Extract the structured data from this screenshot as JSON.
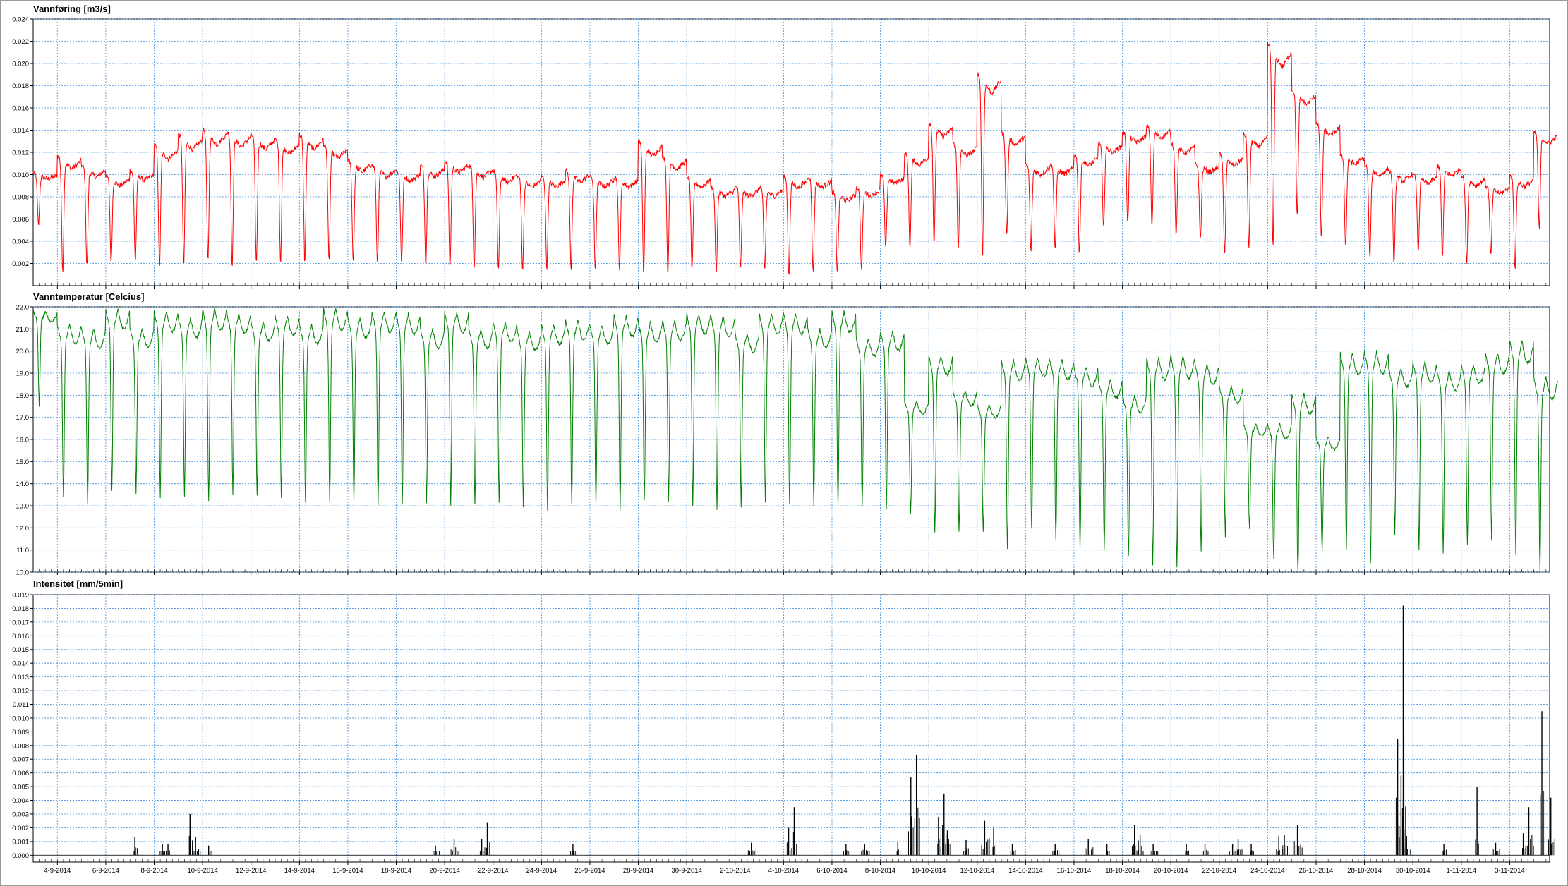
{
  "chart_data": [
    {
      "type": "line",
      "title": "Vannføring [m3/s]",
      "color": "#ff0000",
      "grid": true,
      "ylim": [
        0.0,
        0.024
      ],
      "yticks": [
        "0.002",
        "0.004",
        "0.006",
        "0.008",
        "0.010",
        "0.012",
        "0.014",
        "0.016",
        "0.018",
        "0.020",
        "0.022",
        "0.024"
      ],
      "xlim": [
        "2014-09-03",
        "2014-11-04"
      ],
      "series": [
        {
          "x": [
            "2014-09-03",
            "2014-09-04",
            "2014-09-05",
            "2014-09-06",
            "2014-09-07",
            "2014-09-08",
            "2014-09-09",
            "2014-09-10",
            "2014-09-11",
            "2014-09-12",
            "2014-09-13",
            "2014-09-14",
            "2014-09-15",
            "2014-09-16",
            "2014-09-17",
            "2014-09-18",
            "2014-09-19",
            "2014-09-20",
            "2014-09-21",
            "2014-09-22",
            "2014-09-23",
            "2014-09-24",
            "2014-09-25",
            "2014-09-26",
            "2014-09-27",
            "2014-09-28",
            "2014-09-29",
            "2014-09-30",
            "2014-10-01",
            "2014-10-02",
            "2014-10-03",
            "2014-10-04",
            "2014-10-05",
            "2014-10-06",
            "2014-10-07",
            "2014-10-08",
            "2014-10-09",
            "2014-10-10",
            "2014-10-11",
            "2014-10-12",
            "2014-10-13",
            "2014-10-14",
            "2014-10-15",
            "2014-10-16",
            "2014-10-17",
            "2014-10-18",
            "2014-10-19",
            "2014-10-20",
            "2014-10-21",
            "2014-10-22",
            "2014-10-23",
            "2014-10-24",
            "2014-10-25",
            "2014-10-26",
            "2014-10-27",
            "2014-10-28",
            "2014-10-29",
            "2014-10-30",
            "2014-10-31",
            "2014-11-01",
            "2014-11-02",
            "2014-11-03",
            "2014-11-04"
          ],
          "daily_max": [
            0.0105,
            0.0125,
            0.0115,
            0.0105,
            0.011,
            0.0135,
            0.0145,
            0.015,
            0.0148,
            0.0145,
            0.014,
            0.0145,
            0.0135,
            0.012,
            0.0115,
            0.011,
            0.0115,
            0.012,
            0.0115,
            0.011,
            0.0105,
            0.0105,
            0.011,
            0.0105,
            0.0105,
            0.014,
            0.0125,
            0.0105,
            0.0095,
            0.0095,
            0.0095,
            0.0105,
            0.0105,
            0.009,
            0.0095,
            0.0105,
            0.0125,
            0.0155,
            0.0135,
            0.0205,
            0.0145,
            0.0115,
            0.0115,
            0.0125,
            0.0135,
            0.0145,
            0.015,
            0.0135,
            0.0115,
            0.0125,
            0.0145,
            0.0232,
            0.0185,
            0.0155,
            0.0125,
            0.0115,
            0.011,
            0.0105,
            0.0115,
            0.0105,
            0.0095,
            0.0105,
            0.0145
          ],
          "daily_min": [
            0.006,
            0.0025,
            0.0028,
            0.003,
            0.0032,
            0.003,
            0.0032,
            0.0035,
            0.0032,
            0.0033,
            0.0034,
            0.0034,
            0.0033,
            0.0032,
            0.003,
            0.003,
            0.003,
            0.0028,
            0.0027,
            0.0025,
            0.0024,
            0.0025,
            0.0025,
            0.0024,
            0.0024,
            0.0023,
            0.0024,
            0.0024,
            0.0022,
            0.0023,
            0.0022,
            0.002,
            0.0022,
            0.0021,
            0.0022,
            0.004,
            0.0045,
            0.005,
            0.0045,
            0.0045,
            0.0055,
            0.004,
            0.0042,
            0.004,
            0.006,
            0.0065,
            0.0065,
            0.0055,
            0.005,
            0.004,
            0.0045,
            0.0055,
            0.0075,
            0.0055,
            0.0045,
            0.0035,
            0.003,
            0.004,
            0.0035,
            0.003,
            0.0035,
            0.0025,
            0.006
          ]
        }
      ]
    },
    {
      "type": "line",
      "title": "Vanntemperatur [Celcius]",
      "color": "#008000",
      "grid": true,
      "ylim": [
        10.0,
        22.0
      ],
      "yticks": [
        "10.0",
        "11.0",
        "12.0",
        "13.0",
        "14.0",
        "15.0",
        "16.0",
        "17.0",
        "18.0",
        "19.0",
        "20.0",
        "21.0",
        "22.0"
      ],
      "xlim": [
        "2014-09-03",
        "2014-11-04"
      ],
      "series": [
        {
          "x": [
            "2014-09-03",
            "2014-09-04",
            "2014-09-05",
            "2014-09-06",
            "2014-09-07",
            "2014-09-08",
            "2014-09-09",
            "2014-09-10",
            "2014-09-11",
            "2014-09-12",
            "2014-09-13",
            "2014-09-14",
            "2014-09-15",
            "2014-09-16",
            "2014-09-17",
            "2014-09-18",
            "2014-09-19",
            "2014-09-20",
            "2014-09-21",
            "2014-09-22",
            "2014-09-23",
            "2014-09-24",
            "2014-09-25",
            "2014-09-26",
            "2014-09-27",
            "2014-09-28",
            "2014-09-29",
            "2014-09-30",
            "2014-10-01",
            "2014-10-02",
            "2014-10-03",
            "2014-10-04",
            "2014-10-05",
            "2014-10-06",
            "2014-10-07",
            "2014-10-08",
            "2014-10-09",
            "2014-10-10",
            "2014-10-11",
            "2014-10-12",
            "2014-10-13",
            "2014-10-14",
            "2014-10-15",
            "2014-10-16",
            "2014-10-17",
            "2014-10-18",
            "2014-10-19",
            "2014-10-20",
            "2014-10-21",
            "2014-10-22",
            "2014-10-23",
            "2014-10-24",
            "2014-10-25",
            "2014-10-26",
            "2014-10-27",
            "2014-10-28",
            "2014-10-29",
            "2014-10-30",
            "2014-10-31",
            "2014-11-01",
            "2014-11-02",
            "2014-11-03",
            "2014-11-04"
          ],
          "daily_max": [
            21.8,
            21.2,
            21.0,
            21.9,
            21.0,
            21.8,
            21.5,
            21.9,
            21.7,
            21.3,
            21.6,
            21.2,
            21.9,
            21.5,
            21.8,
            21.7,
            21.0,
            21.8,
            21.0,
            21.3,
            20.9,
            21.2,
            21.4,
            21.2,
            21.6,
            21.3,
            21.4,
            21.7,
            21.6,
            20.8,
            21.7,
            21.7,
            21.0,
            21.8,
            20.6,
            20.9,
            17.7,
            19.8,
            18.2,
            17.6,
            19.6,
            19.7,
            19.6,
            19.3,
            18.7,
            18.0,
            19.7,
            19.8,
            19.4,
            18.4,
            16.7,
            16.7,
            18.1,
            16.1,
            19.9,
            20.0,
            19.2,
            19.5,
            19.1,
            19.4,
            19.9,
            20.5,
            18.8
          ],
          "daily_min": [
            18.0,
            14.2,
            13.9,
            14.6,
            14.4,
            14.3,
            14.3,
            14.1,
            14.4,
            14.3,
            14.2,
            14.0,
            14.1,
            14.1,
            14.0,
            14.0,
            14.0,
            14.0,
            13.9,
            14.0,
            13.8,
            13.7,
            14.0,
            13.9,
            13.8,
            14.1,
            14.1,
            13.9,
            13.7,
            13.8,
            14.0,
            14.0,
            13.9,
            13.9,
            13.8,
            13.7,
            13.2,
            12.6,
            12.5,
            12.4,
            12.0,
            12.8,
            12.3,
            12.0,
            11.9,
            11.5,
            11.3,
            11.2,
            11.9,
            12.3,
            12.4,
            11.3,
            10.5,
            11.5,
            11.9,
            11.5,
            12.5,
            11.9,
            11.7,
            12.1,
            12.4,
            11.8,
            10.9
          ]
        }
      ]
    },
    {
      "type": "bar",
      "title": "Intensitet [mm/5min]",
      "color": "#000000",
      "grid": true,
      "ylim": [
        -0.0005,
        0.019
      ],
      "yticks": [
        "0.000",
        "0.001",
        "0.002",
        "0.003",
        "0.004",
        "0.005",
        "0.006",
        "0.007",
        "0.008",
        "0.009",
        "0.010",
        "0.011",
        "0.012",
        "0.013",
        "0.014",
        "0.015",
        "0.016",
        "0.017",
        "0.018",
        "0.019"
      ],
      "xlim": [
        "2014-09-03",
        "2014-11-04"
      ],
      "series": [
        {
          "x": [
            "2014-09-07",
            "2014-09-08",
            "2014-09-08",
            "2014-09-09",
            "2014-09-09",
            "2014-09-10",
            "2014-09-19",
            "2014-09-20",
            "2014-09-21",
            "2014-09-21",
            "2014-09-25",
            "2014-10-02",
            "2014-10-04",
            "2014-10-04",
            "2014-10-06",
            "2014-10-07",
            "2014-10-08",
            "2014-10-09",
            "2014-10-09",
            "2014-10-10",
            "2014-10-10",
            "2014-10-10",
            "2014-10-11",
            "2014-10-12",
            "2014-10-12",
            "2014-10-13",
            "2014-10-15",
            "2014-10-16",
            "2014-10-17",
            "2014-10-18",
            "2014-10-18",
            "2014-10-19",
            "2014-10-20",
            "2014-10-21",
            "2014-10-22",
            "2014-10-22",
            "2014-10-23",
            "2014-10-24",
            "2014-10-24",
            "2014-10-25",
            "2014-10-29",
            "2014-10-29",
            "2014-10-29",
            "2014-10-29",
            "2014-10-31",
            "2014-11-01",
            "2014-11-02",
            "2014-11-03",
            "2014-11-03",
            "2014-11-04",
            "2014-11-04"
          ],
          "values": [
            0.0013,
            0.0008,
            0.0008,
            0.0013,
            0.003,
            0.0007,
            0.0007,
            0.0012,
            0.0024,
            0.0012,
            0.0008,
            0.0009,
            0.0035,
            0.002,
            0.0008,
            0.0008,
            0.001,
            0.0073,
            0.0057,
            0.0045,
            0.0028,
            0.0018,
            0.0011,
            0.0025,
            0.002,
            0.0008,
            0.0008,
            0.0012,
            0.0008,
            0.0015,
            0.0022,
            0.0008,
            0.0008,
            0.0008,
            0.0012,
            0.0008,
            0.0008,
            0.0015,
            0.0014,
            0.0022,
            0.0182,
            0.0085,
            0.0014,
            0.0058,
            0.0008,
            0.005,
            0.0009,
            0.0035,
            0.0016,
            0.0105,
            0.0042
          ]
        }
      ]
    }
  ],
  "x_tick_labels": [
    "4-9-2014",
    "6-9-2014",
    "8-9-2014",
    "10-9-2014",
    "12-9-2014",
    "14-9-2014",
    "16-9-2014",
    "18-9-2014",
    "20-9-2014",
    "22-9-2014",
    "24-9-2014",
    "26-9-2014",
    "28-9-2014",
    "30-9-2014",
    "2-10-2014",
    "4-10-2014",
    "6-10-2014",
    "8-10-2014",
    "10-10-2014",
    "12-10-2014",
    "14-10-2014",
    "16-10-2014",
    "18-10-2014",
    "20-10-2014",
    "22-10-2014",
    "24-10-2014",
    "26-10-2014",
    "28-10-2014",
    "30-10-2014",
    "1-11-2014",
    "3-11-2014"
  ],
  "colors": {
    "grid": "#3c8fdc",
    "axis": "#000000",
    "background": "#ffffff"
  }
}
